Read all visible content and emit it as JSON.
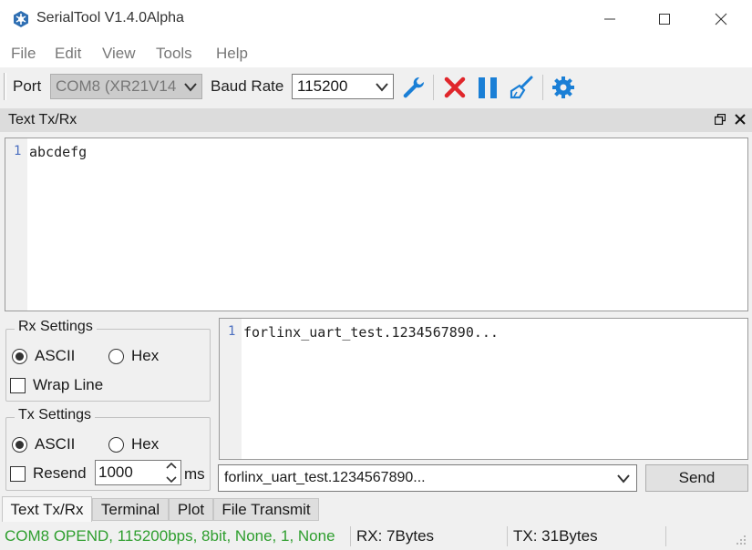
{
  "window": {
    "title": "SerialTool V1.4.0Alpha",
    "icon": "serialtool-app-icon"
  },
  "menu": {
    "items": [
      {
        "label": "File"
      },
      {
        "label": "Edit"
      },
      {
        "label": "View"
      },
      {
        "label": "Tools"
      },
      {
        "label": "Help"
      }
    ]
  },
  "toolbar": {
    "port_label": "Port",
    "port_value": "COM8 (XR21V14",
    "baud_label": "Baud Rate",
    "baud_value": "115200",
    "icons": [
      "wrench-icon",
      "close-port-icon",
      "pause-icon",
      "clear-broom-icon",
      "settings-gear-icon"
    ],
    "colors": {
      "wrench": "#1a7fd6",
      "close": "#e0262b",
      "pause": "#1a7fd6",
      "broom": "#1a7fd6",
      "gear": "#1a7fd6"
    }
  },
  "dock": {
    "title": "Text Tx/Rx"
  },
  "receive_editor": {
    "lines": [
      {
        "number": "1",
        "text": "abcdefg"
      }
    ]
  },
  "rx_settings": {
    "title": "Rx Settings",
    "ascii_label": "ASCII",
    "hex_label": "Hex",
    "wrap_label": "Wrap Line",
    "selected": "ASCII",
    "wrap_checked": false
  },
  "tx_settings": {
    "title": "Tx Settings",
    "ascii_label": "ASCII",
    "hex_label": "Hex",
    "resend_label": "Resend",
    "resend_interval": "1000",
    "unit": "ms",
    "selected": "ASCII",
    "resend_checked": false
  },
  "send_editor": {
    "lines": [
      {
        "number": "1",
        "text": "forlinx_uart_test.1234567890..."
      }
    ]
  },
  "send_bar": {
    "history_value": "forlinx_uart_test.1234567890...",
    "send_label": "Send"
  },
  "tabs": [
    {
      "label": "Text Tx/Rx",
      "active": true
    },
    {
      "label": "Terminal",
      "active": false
    },
    {
      "label": "Plot",
      "active": false
    },
    {
      "label": "File Transmit",
      "active": false
    }
  ],
  "status": {
    "port_status": "COM8 OPEND, 115200bps, 8bit, None, 1, None",
    "rx": "RX: 7Bytes",
    "tx": "TX: 31Bytes",
    "port_status_color": "#2e9e2e"
  }
}
